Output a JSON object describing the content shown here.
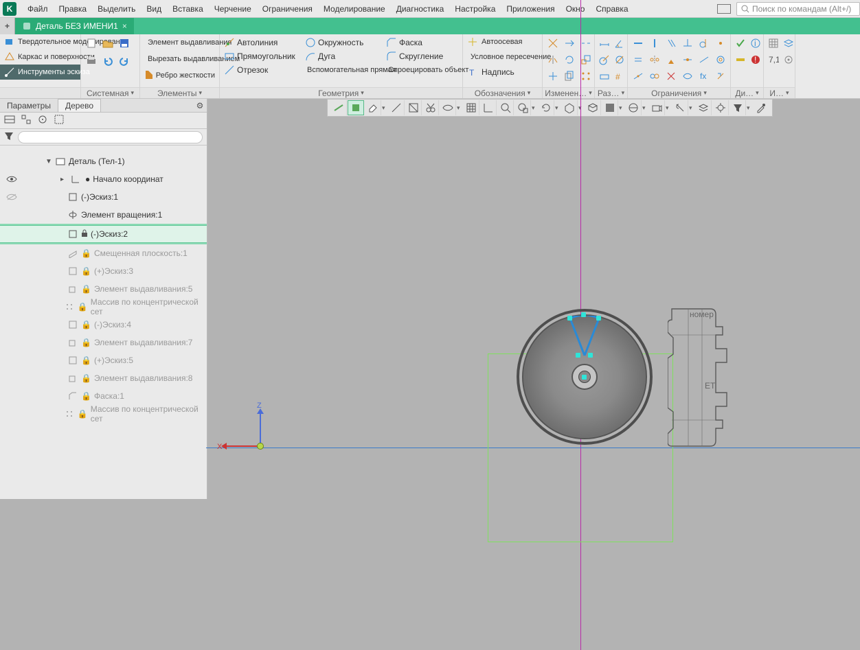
{
  "menu": {
    "items": [
      "Файл",
      "Правка",
      "Выделить",
      "Вид",
      "Вставка",
      "Черчение",
      "Ограничения",
      "Моделирование",
      "Диагностика",
      "Настройка",
      "Приложения",
      "Окно",
      "Справка"
    ],
    "search_placeholder": "Поиск по командам (Alt+/)"
  },
  "tab": {
    "title": "Деталь БЕЗ ИМЕНИ1"
  },
  "ribbon": {
    "modes": {
      "solid": "Твердотельное моделирование",
      "wire": "Каркас и поверхности",
      "sketch": "Инструменты эскиза"
    },
    "group_labels": {
      "system": "Системная",
      "elements": "Элементы",
      "geometry": "Геометрия",
      "annot": "Обозначения",
      "edit": "Изменен…",
      "dim": "Раз…",
      "constr": "Ограничения",
      "diag": "Ди…",
      "tools": "И…"
    },
    "elements": {
      "extrude": "Элемент выдавливания",
      "cut_extrude": "Вырезать выдавливанием",
      "rib": "Ребро жесткости"
    },
    "geometry": {
      "autoline": "Автолиния",
      "rect": "Прямоугольник",
      "segment": "Отрезок",
      "circle": "Окружность",
      "arc": "Дуга",
      "aux_line": "Вспомогательная прямая",
      "chamfer": "Фаска",
      "fillet": "Скругление",
      "project": "Спроецировать объект"
    },
    "annot": {
      "autoaxis": "Автоосевая",
      "cond": "Условное пересечение",
      "text": "Надпись"
    }
  },
  "leftpanel": {
    "tab_params": "Параметры",
    "tab_tree": "Дерево"
  },
  "tree": {
    "root": "Деталь (Тел-1)",
    "origin": "Начало координат",
    "sketch1": "(-)Эскиз:1",
    "revolve1": "Элемент вращения:1",
    "sketch2": "(-)Эскиз:2",
    "plane1": "Смещенная плоскость:1",
    "sketch3": "(+)Эскиз:3",
    "extrude5": "Элемент выдавливания:5",
    "array1": "Массив по концентрической сет",
    "sketch4": "(-)Эскиз:4",
    "extrude7": "Элемент выдавливания:7",
    "sketch5": "(+)Эскиз:5",
    "extrude8": "Элемент выдавливания:8",
    "chamfer1": "Фаска:1",
    "array2": "Массив по концентрической сет"
  },
  "axis": {
    "x": "X",
    "z": "Z"
  }
}
